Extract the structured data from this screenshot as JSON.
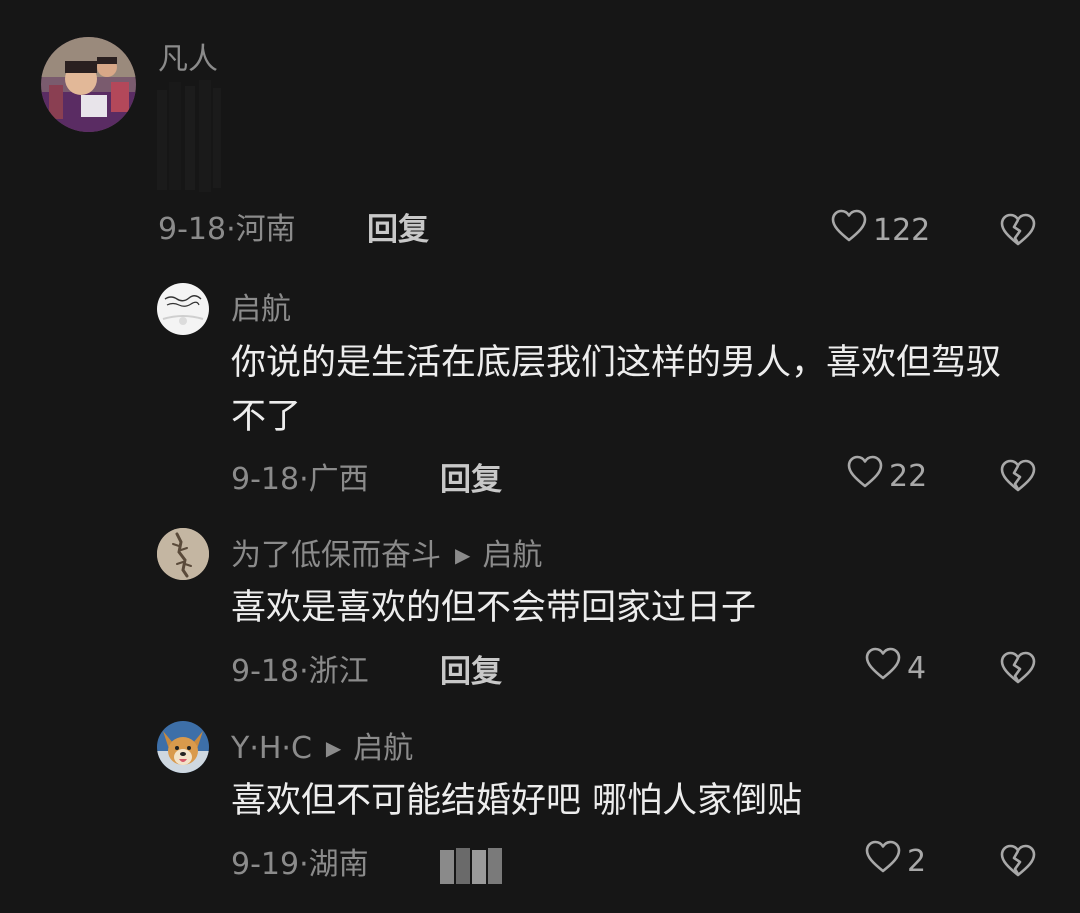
{
  "comments": [
    {
      "username": "凡人",
      "text": "",
      "date": "9-18",
      "location": "河南",
      "reply_label": "回复",
      "likes": "122"
    },
    {
      "username": "启航",
      "text": "你说的是生活在底层我们这样的男人，喜欢但驾驭不了",
      "date": "9-18",
      "location": "广西",
      "reply_label": "回复",
      "likes": "22"
    },
    {
      "username": "为了低保而奋斗",
      "reply_to": "启航",
      "text": "喜欢是喜欢的但不会带回家过日子",
      "date": "9-18",
      "location": "浙江",
      "reply_label": "回复",
      "likes": "4"
    },
    {
      "username": "Y·H·C",
      "reply_to": "启航",
      "text": "喜欢但不可能结婚好吧 哪怕人家倒贴",
      "date": "9-19",
      "location": "湖南",
      "likes": "2"
    }
  ],
  "icons": {
    "like": "heart-outline-icon",
    "dislike": "broken-heart-icon",
    "reply_arrow": "play-triangle-icon"
  },
  "colors": {
    "background": "#161616",
    "primary_text": "#ededed",
    "secondary_text": "#8b8b8b"
  }
}
